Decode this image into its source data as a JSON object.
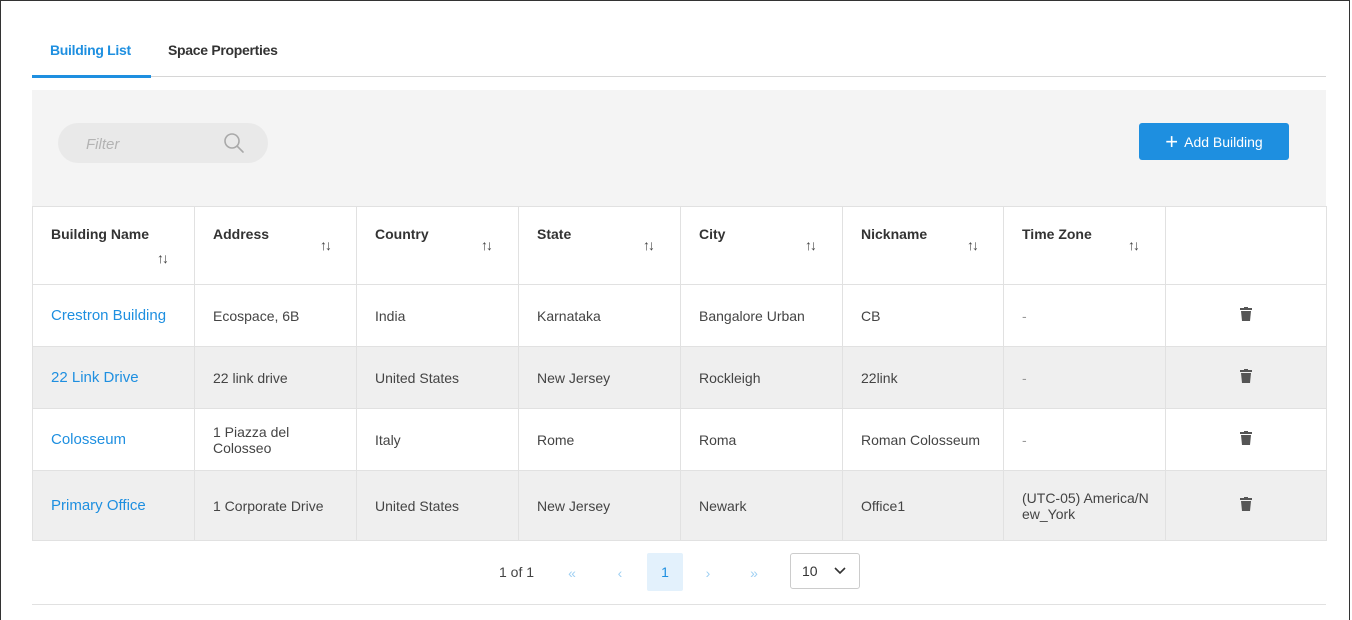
{
  "tabs": [
    {
      "label": "Building List",
      "active": true
    },
    {
      "label": "Space Properties",
      "active": false
    }
  ],
  "toolbar": {
    "filter_placeholder": "Filter",
    "add_button_label": "Add Building",
    "accent_color": "#1e8fe0"
  },
  "table": {
    "columns": [
      "Building Name",
      "Address",
      "Country",
      "State",
      "City",
      "Nickname",
      "Time Zone"
    ],
    "rows": [
      {
        "name": "Crestron Building",
        "address": "Ecospace, 6B",
        "country": "India",
        "state": "Karnataka",
        "city": "Bangalore Urban",
        "nickname": "CB",
        "timezone": "-"
      },
      {
        "name": "22 Link Drive",
        "address": "22 link drive",
        "country": "United States",
        "state": "New Jersey",
        "city": "Rockleigh",
        "nickname": "22link",
        "timezone": "-"
      },
      {
        "name": "Colosseum",
        "address": "1 Piazza del Colosseo",
        "country": "Italy",
        "state": "Rome",
        "city": "Roma",
        "nickname": "Roman Colosseum",
        "timezone": "-"
      },
      {
        "name": "Primary Office",
        "address": "1 Corporate Drive",
        "country": "United States",
        "state": "New Jersey",
        "city": "Newark",
        "nickname": "Office1",
        "timezone": "(UTC-05) America/New_York"
      }
    ]
  },
  "pagination": {
    "info": "1 of 1",
    "first": "«",
    "prev": "‹",
    "current_page": "1",
    "next": "›",
    "last": "»",
    "page_size": "10"
  }
}
